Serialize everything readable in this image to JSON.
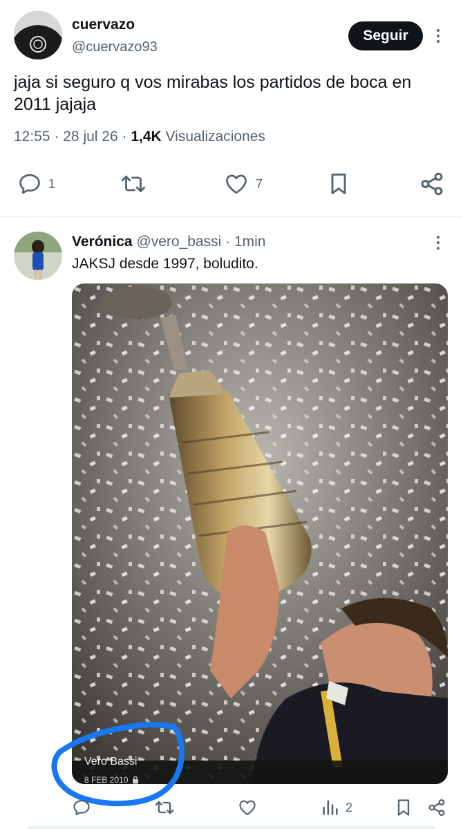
{
  "tweet1": {
    "display_name": "cuervazo",
    "handle": "@cuervazo93",
    "follow_label": "Seguir",
    "text": "jaja si seguro q vos mirabas los partidos de boca en 2011 jajaja",
    "time": "12:55",
    "date": "28 jul 26",
    "separator": "·",
    "views_count": "1,4K",
    "views_label": "Visualizaciones",
    "actions": {
      "replies": "1",
      "likes": "7"
    }
  },
  "tweet2": {
    "display_name": "Verónica",
    "handle": "@vero_bassi",
    "separator": "·",
    "time_ago": "1min",
    "text": "JAKSJ desde 1997, boludito.",
    "photo": {
      "caption_name": "Vero Bassi",
      "caption_date": "8 FEB 2010"
    },
    "actions": {
      "views": "2"
    }
  },
  "colors": {
    "text": "#0f1419",
    "muted": "#536471",
    "divider": "#eff3f4",
    "annotation_circle": "#1877f2"
  },
  "icons": [
    "reply-icon",
    "retweet-icon",
    "like-icon",
    "bookmark-icon",
    "share-icon",
    "views-icon",
    "lock-icon",
    "more-icon"
  ]
}
